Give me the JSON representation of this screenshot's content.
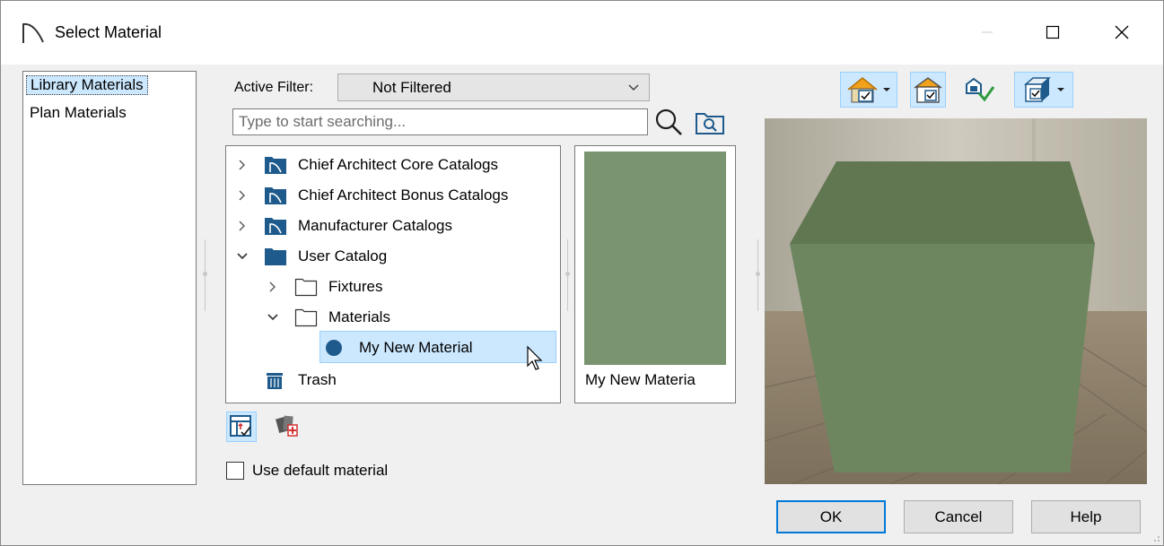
{
  "window": {
    "title": "Select Material",
    "controls": {
      "minimize": "minimize-icon",
      "maximize": "maximize-icon",
      "close": "close-icon"
    }
  },
  "library_list": {
    "items": [
      {
        "label": "Library Materials",
        "selected": true
      },
      {
        "label": "Plan Materials",
        "selected": false
      }
    ]
  },
  "filter": {
    "label": "Active Filter:",
    "value": "Not Filtered"
  },
  "search": {
    "placeholder": "Type to start searching..."
  },
  "tree": {
    "items": [
      {
        "label": "Chief Architect Core Catalogs",
        "level": 0,
        "expanded": false,
        "icon": "catalog-folder-icon"
      },
      {
        "label": "Chief Architect Bonus Catalogs",
        "level": 0,
        "expanded": false,
        "icon": "catalog-folder-icon"
      },
      {
        "label": "Manufacturer Catalogs",
        "level": 0,
        "expanded": false,
        "icon": "catalog-folder-icon"
      },
      {
        "label": "User Catalog",
        "level": 0,
        "expanded": true,
        "icon": "user-folder-icon"
      },
      {
        "label": "Fixtures",
        "level": 1,
        "expanded": false,
        "icon": "folder-outline-icon"
      },
      {
        "label": "Materials",
        "level": 1,
        "expanded": true,
        "icon": "folder-outline-icon"
      },
      {
        "label": "My New Material",
        "level": 2,
        "selected": true,
        "icon": "material-dot-icon"
      },
      {
        "label": "Trash",
        "level": 0,
        "icon": "trash-icon"
      }
    ]
  },
  "preview": {
    "name": "My New Materia",
    "swatch_color": "#7a9470"
  },
  "options": {
    "use_default_label": "Use default material",
    "use_default_checked": false
  },
  "buttons": {
    "ok": "OK",
    "cancel": "Cancel",
    "help": "Help"
  },
  "colors": {
    "accent": "#0078d7",
    "selection": "#cce8ff",
    "catalog_blue": "#1e5b8c",
    "material_green": "#6e8a63"
  }
}
